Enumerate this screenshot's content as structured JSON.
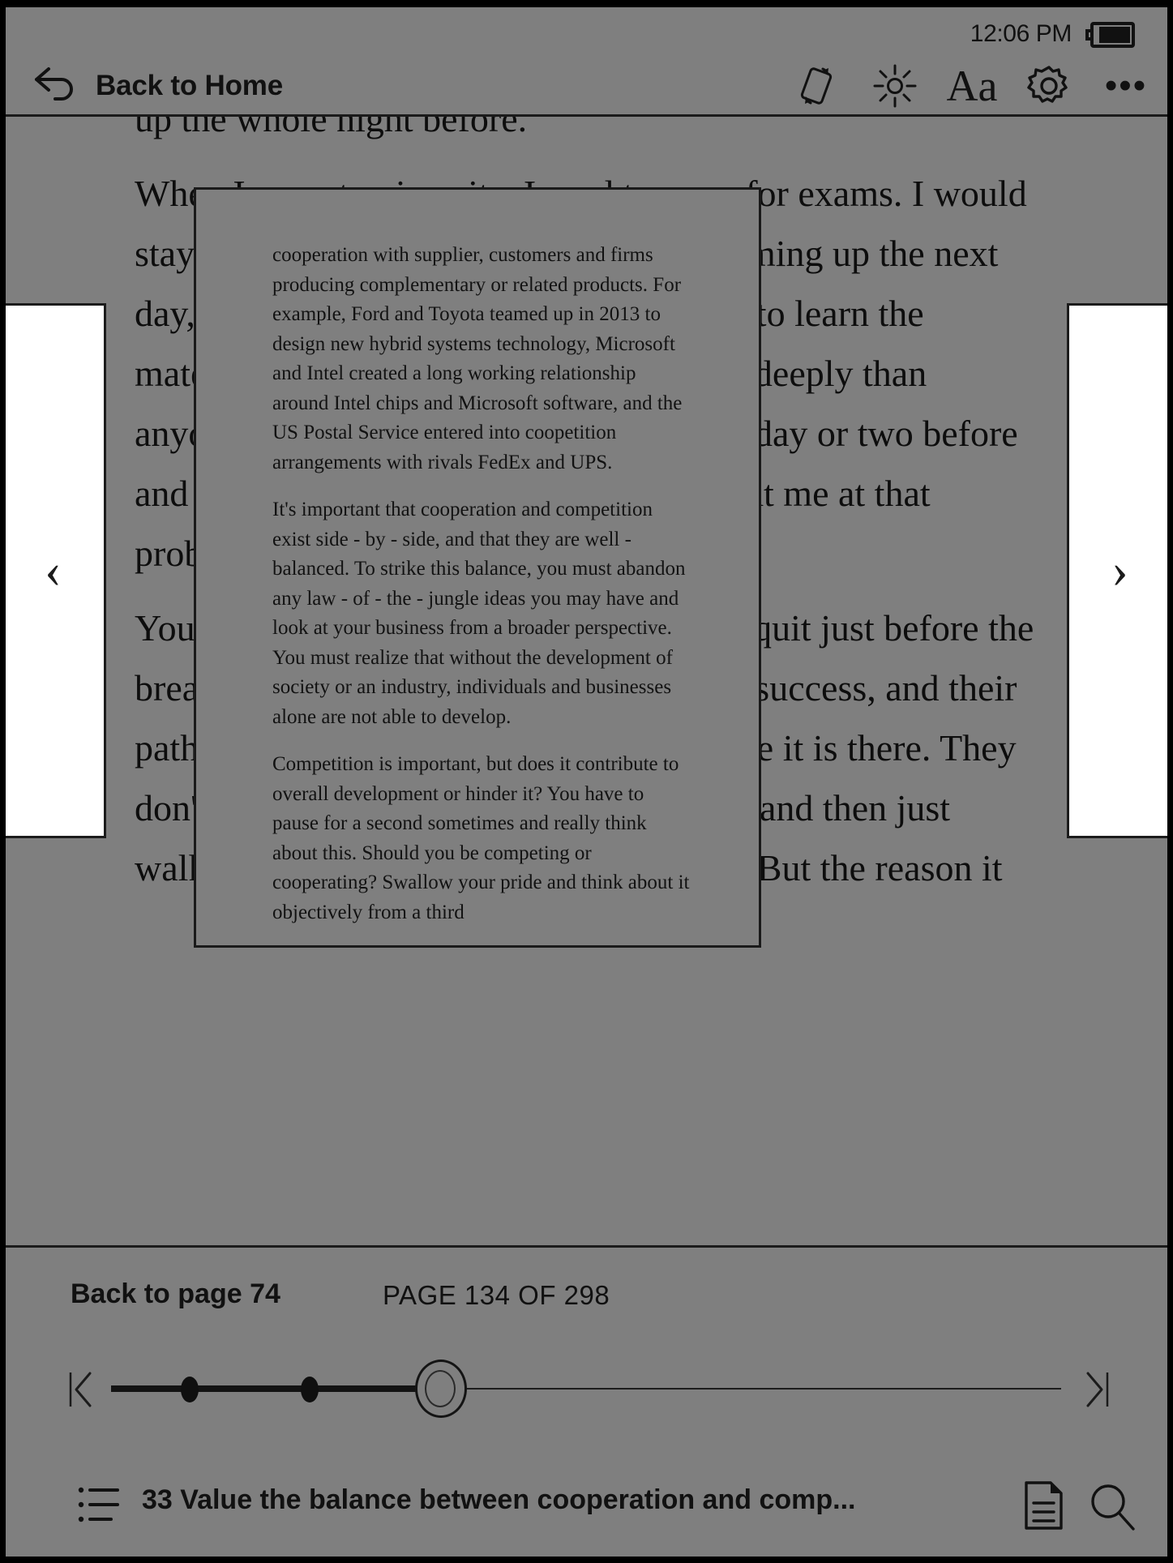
{
  "status": {
    "time": "12:06 PM",
    "battery_icon": "battery-full-icon"
  },
  "toolbar": {
    "back_label": "Back to Home",
    "back_icon": "back-arrow-icon",
    "icons": [
      {
        "name": "rotate-screen-icon",
        "label": "Rotate"
      },
      {
        "name": "brightness-icon",
        "label": "Brightness"
      },
      {
        "name": "font-size-icon",
        "label": "Aa"
      },
      {
        "name": "settings-gear-icon",
        "label": "Settings"
      },
      {
        "name": "more-options-icon",
        "label": "•••"
      }
    ]
  },
  "navigation": {
    "prev_chevron": "‹",
    "next_chevron": "›"
  },
  "book_page": {
    "paragraphs": [
      "up the whole night before.",
      "When I was at university, I used to cram for exams. I would stay up all night when there was a test coming up the next day, studying for hours. I didn't just want to learn the material; I wanted to know it much more deeply than anyone else. Most people quit studying a day or two before and take a test exhausted. You'll never beat me at that problem.",
      "You'd be amazed at how many of today's quit just before the breakthrough. A person is on the point of success, and their path is blocked, so they give up just before it is there. They don't know that some may be on the cusp and then just walked them at all in their working lives. But the reason it"
    ]
  },
  "preview_popup": {
    "paragraphs": [
      "cooperation with supplier, customers and firms producing complementary or related products. For example, Ford and Toyota teamed up in 2013 to design new hybrid systems technology, Microsoft and Intel created a long working relationship around Intel chips and Microsoft software, and the US Postal Service entered into coopetition arrangements with rivals FedEx and UPS.",
      "It's important that cooperation and competition exist side - by - side, and that they are well - balanced. To strike this balance, you must abandon any law - of - the - jungle ideas you may have and look at your business from a broader perspective. You must realize that without the development of society or an industry, individuals and businesses alone are not able to develop.",
      "Competition is important, but does it contribute to overall development or hinder it? You have to pause for a second sometimes and really think about this. Should you be competing or cooperating? Swallow your pride and think about it objectively from a third"
    ]
  },
  "bottom": {
    "back_to_page": "Back to page 74",
    "page_indicator": "PAGE 134 OF 298",
    "current_page": 134,
    "total_pages": 298,
    "slider_first_icon": "jump-to-start-icon",
    "slider_last_icon": "jump-to-end-icon",
    "chapter_title": "33 Value the balance between cooperation and comp...",
    "toc_icon": "table-of-contents-icon",
    "notes_icon": "notes-page-icon",
    "search_icon": "search-icon"
  },
  "colors": {
    "screen_bg": "#7f7f7f",
    "ink": "#111111",
    "panel_white": "#ffffff",
    "bezel": "#000000"
  }
}
